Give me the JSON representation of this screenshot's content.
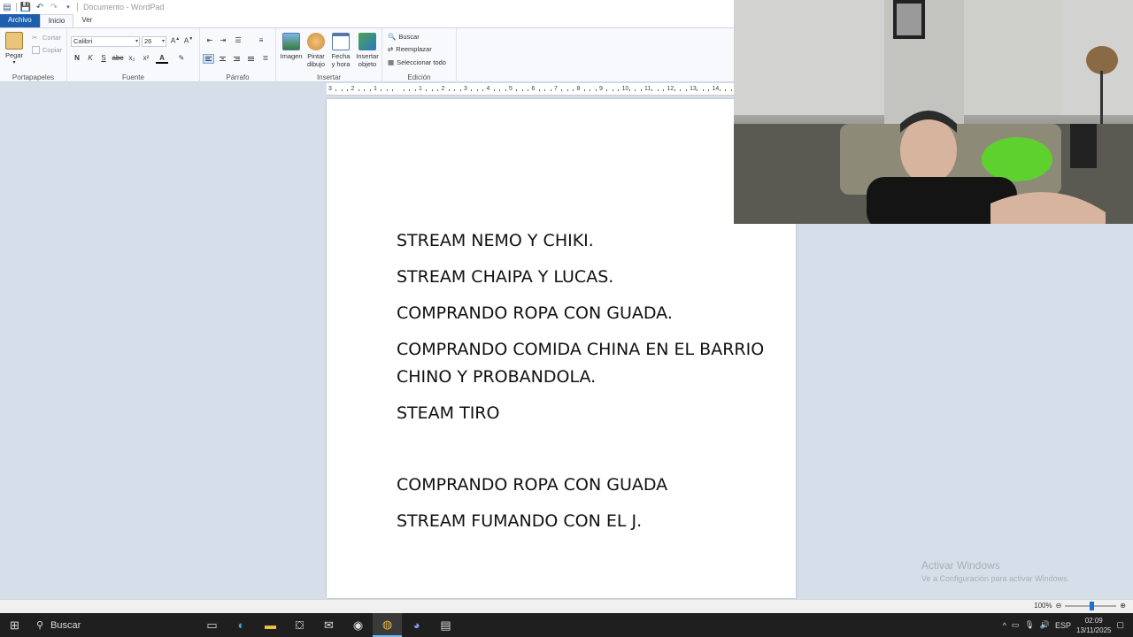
{
  "window": {
    "title": "Documento - WordPad"
  },
  "tabs": [
    {
      "label": "Archivo"
    },
    {
      "label": "Inicio"
    },
    {
      "label": "Ver"
    }
  ],
  "ribbon": {
    "clipboard": {
      "label": "Portapapeles",
      "paste": "Pegar",
      "cut": "Cortar",
      "copy": "Copiar"
    },
    "font": {
      "label": "Fuente",
      "family": "Calibri",
      "size": "26",
      "bold": "N",
      "italic": "K",
      "underline": "S",
      "strike": "abc",
      "subscript": "x₂",
      "superscript": "x²",
      "color_letter": "A"
    },
    "paragraph": {
      "label": "Párrafo"
    },
    "insert": {
      "label": "Insertar",
      "image": "Imagen",
      "paint": "Pintar dibujo",
      "datetime": "Fecha y hora",
      "object": "Insertar objeto"
    },
    "edit": {
      "label": "Edición",
      "find": "Buscar",
      "replace": "Reemplazar",
      "select_all": "Seleccionar todo"
    }
  },
  "document": {
    "lines": [
      "STREAM NEMO Y CHIKI.",
      "STREAM CHAIPA Y LUCAS.",
      "COMPRANDO ROPA CON GUADA.",
      "COMPRANDO COMIDA CHINA EN EL BARRIO CHINO Y  PROBANDOLA.",
      "STEAM TIRO",
      "",
      "COMPRANDO ROPA CON GUADA",
      "STREAM FUMANDO CON EL J."
    ]
  },
  "statusbar": {
    "zoom": "100%",
    "zoom_fraction": 0.5
  },
  "watermark": {
    "title": "Activar Windows",
    "subtitle": "Ve a Configuración para activar Windows."
  },
  "taskbar": {
    "search": "Buscar",
    "tray": {
      "language": "ESP",
      "time": "02:09",
      "date": "13/11/2025"
    }
  },
  "colors": {
    "accent": "#1d5fae",
    "taskbar": "#1f1f1f",
    "desktop": "#d6dfe9"
  }
}
